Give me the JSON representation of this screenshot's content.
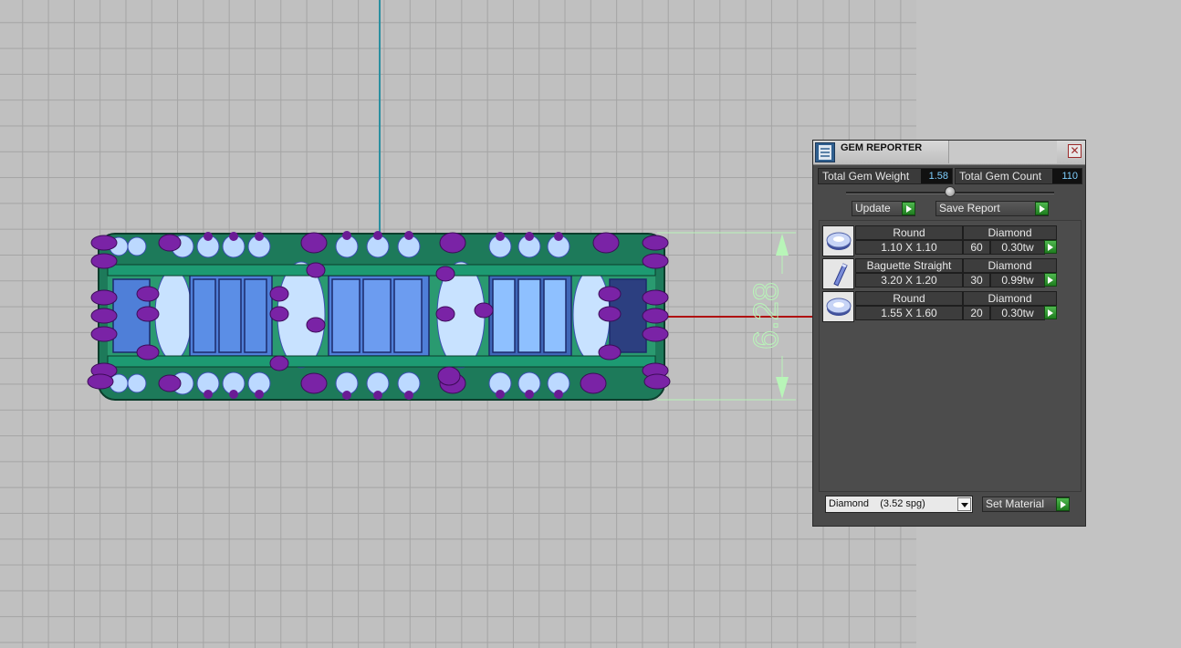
{
  "dimension": {
    "value": "6.28"
  },
  "panel": {
    "title": "GEM REPORTER",
    "close_glyph": "✕",
    "total_weight_label": "Total Gem Weight",
    "total_weight_value": "1.58",
    "total_count_label": "Total Gem Count",
    "total_count_value": "110",
    "update_label": "Update",
    "save_report_label": "Save Report",
    "gems": [
      {
        "cut": "Round",
        "material": "Diamond",
        "size": "1.10 X 1.10",
        "count": "60",
        "weight": "0.30tw",
        "icon": "round-gem-icon"
      },
      {
        "cut": "Baguette Straight",
        "material": "Diamond",
        "size": "3.20 X 1.20",
        "count": "30",
        "weight": "0.99tw",
        "icon": "baguette-gem-icon"
      },
      {
        "cut": "Round",
        "material": "Diamond",
        "size": "1.55 X 1.60",
        "count": "20",
        "weight": "0.30tw",
        "icon": "round-gem-icon"
      }
    ],
    "material_select": {
      "value": "Diamond    (3.52 spg)"
    },
    "set_material_label": "Set Material"
  },
  "colors": {
    "viewport_bg": "#c0c0c0",
    "grid_line": "#a4a4a4",
    "metal": "#1f8a66",
    "prong": "#7a23a6",
    "gem_blue": "#4f7fd8",
    "gem_light": "#b9d8ff",
    "axis_y": "#2a8ea0",
    "axis_x": "#b01010",
    "dimension": "#b8f5b8"
  }
}
